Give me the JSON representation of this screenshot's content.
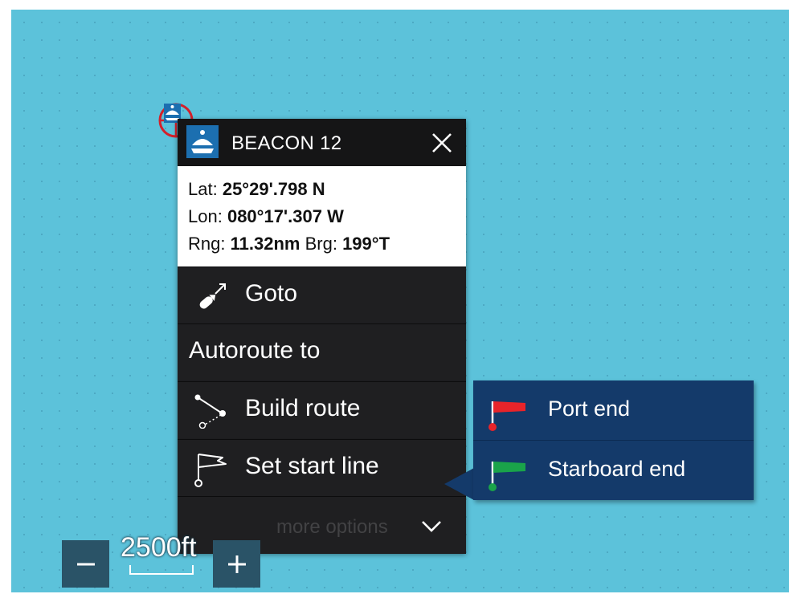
{
  "waypoint": {
    "title": "BEACON 12",
    "lat_label": "Lat:",
    "lat_value": "25°29'.798 N",
    "lon_label": "Lon:",
    "lon_value": "080°17'.307 W",
    "rng_label": "Rng:",
    "rng_value": "11.32nm",
    "brg_label": "Brg:",
    "brg_value": "199°T"
  },
  "menu": {
    "goto_label": "Goto",
    "autoroute_label": "Autoroute to",
    "build_route_label": "Build route",
    "set_start_line_label": "Set start line",
    "more_options_label": "more options"
  },
  "submenu": {
    "port_end_label": "Port end",
    "starboard_end_label": "Starboard end"
  },
  "zoom": {
    "scale_label": "2500ft",
    "minus_label": "−",
    "plus_label": "+"
  },
  "colors": {
    "sea": "#5cc2da",
    "popup_bg": "#1c1c1e",
    "submenu_bg": "#143a6a",
    "port_flag": "#e8242a",
    "starboard_flag": "#1aa34a",
    "accent_blue": "#1c6fb0"
  },
  "icons": {
    "marker": "buoy-target-icon",
    "header": "buoy-icon",
    "close": "close-icon",
    "goto": "goto-arrow-icon",
    "build_route": "route-icon",
    "start_line": "flag-icon",
    "more": "chevron-down-icon"
  }
}
